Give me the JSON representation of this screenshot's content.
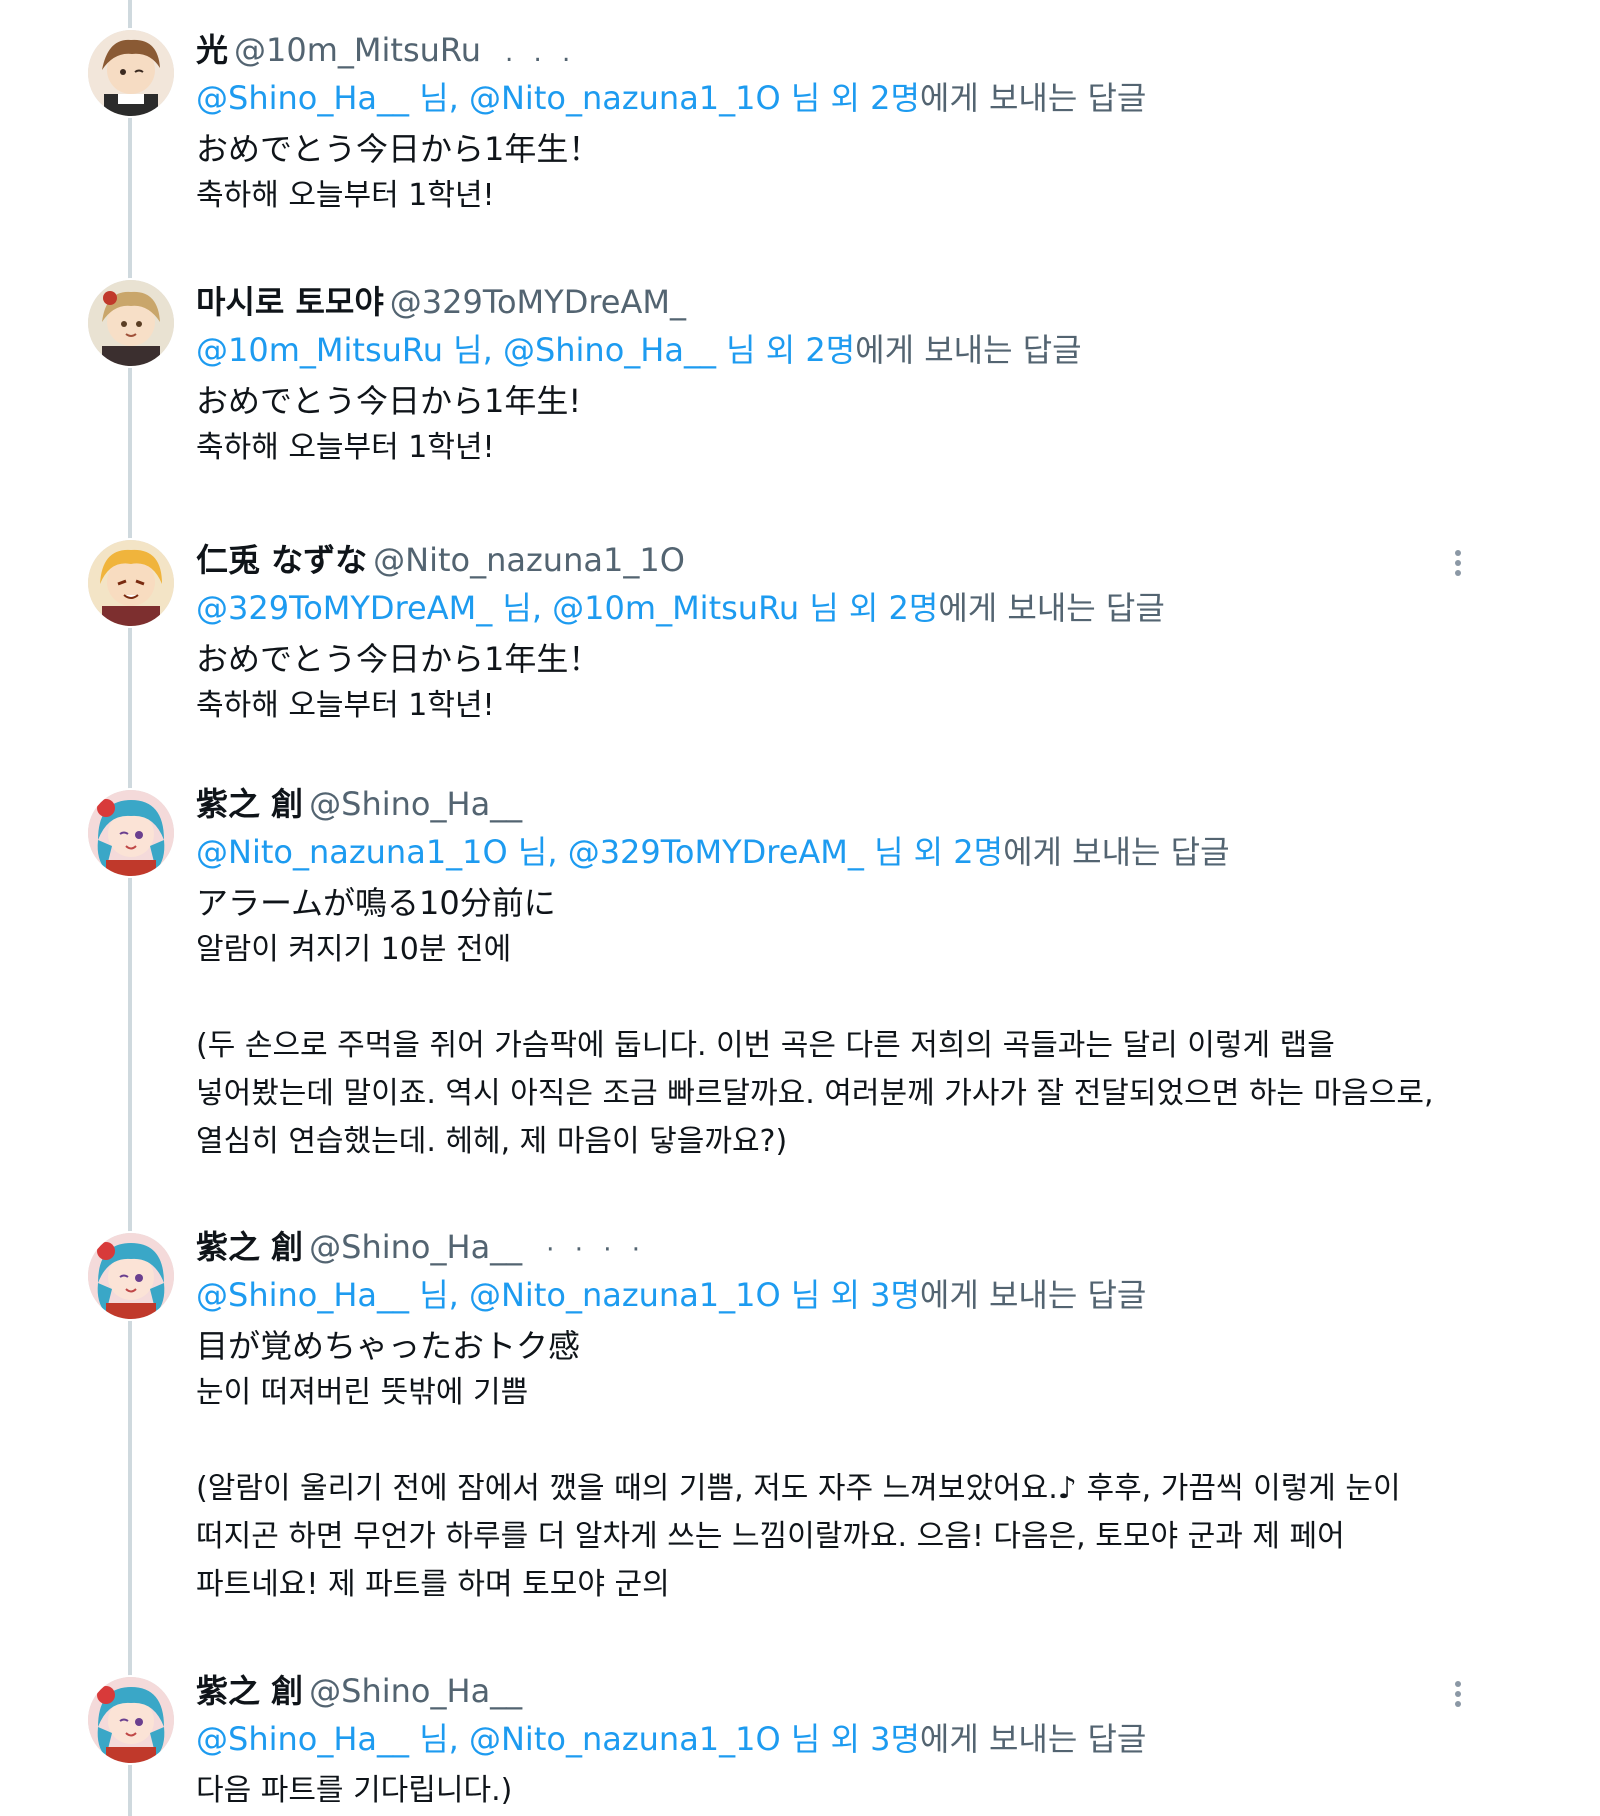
{
  "thread": {
    "reply_to_prefix_separator": "님,",
    "reply_to_middle": "님 외",
    "reply_to_suffix": "에게 보내는 답글"
  },
  "tweets": [
    {
      "display_name": "光",
      "handle": "@10m_MitsuRu",
      "trail": ". . .",
      "mention_1": "@Shino_Ha__",
      "mention_2": "@Nito_nazuna1_1O",
      "count": "2명",
      "lines_jp": [
        "おめでとう今日から1年生！"
      ],
      "lines_kr": [
        "축하해 오늘부터 1학년!"
      ]
    },
    {
      "display_name": "마시로 토모야",
      "handle": "@329ToMYDreAM_",
      "trail": "",
      "mention_1": "@10m_MitsuRu",
      "mention_2": "@Shino_Ha__",
      "count": "2명",
      "lines_jp": [
        "おめでとう今日から1年生!"
      ],
      "lines_kr": [
        "축하해 오늘부터 1학년!"
      ]
    },
    {
      "display_name": "仁兎 なずな",
      "handle": "@Nito_nazuna1_1O",
      "trail": "",
      "mention_1": "@329ToMYDreAM_",
      "mention_2": "@10m_MitsuRu",
      "count": "2명",
      "lines_jp": [
        "おめでとう今日から1年生！"
      ],
      "lines_kr": [
        "축하해 오늘부터 1학년!"
      ]
    },
    {
      "display_name": "紫之 創",
      "handle": "@Shino_Ha__",
      "trail": "",
      "mention_1": "@Nito_nazuna1_1O",
      "mention_2": "@329ToMYDreAM_",
      "count": "2명",
      "lines_jp": [
        "アラームが鳴る10分前に"
      ],
      "lines_kr": [
        "알람이 켜지기 10분 전에"
      ],
      "paragraph": [
        "(두 손으로 주먹을 쥐어 가슴팍에 둡니다. 이번 곡은 다른 저희의 곡들과는 달리 이렇게 랩을",
        "넣어봤는데 말이죠. 역시 아직은 조금 빠르달까요. 여러분께 가사가 잘 전달되었으면 하는 마음으로,",
        "열심히 연습했는데. 헤헤, 제 마음이 닿을까요?)"
      ]
    },
    {
      "display_name": "紫之 創",
      "handle": "@Shino_Ha__",
      "trail": "· · · ·",
      "mention_1": "@Shino_Ha__",
      "mention_2": "@Nito_nazuna1_1O",
      "count": "3명",
      "lines_jp": [
        "目が覚めちゃったおトク感"
      ],
      "lines_kr": [
        "눈이 떠져버린 뜻밖에 기쁨"
      ],
      "paragraph": [
        "(알람이 울리기 전에 잠에서 깼을 때의 기쁨, 저도 자주 느껴보았어요.♪ 후후, 가끔씩 이렇게 눈이",
        "떠지곤 하면 무언가 하루를 더 알차게 쓰는 느낌이랄까요. 으음! 다음은, 토모야 군과 제 페어",
        "파트네요! 제 파트를 하며 토모야 군의"
      ]
    },
    {
      "display_name": "紫之 創",
      "handle": "@Shino_Ha__",
      "trail": "",
      "mention_1": "@Shino_Ha__",
      "mention_2": "@Nito_nazuna1_1O",
      "count": "3명",
      "lines_jp": [],
      "lines_kr": [
        "다음 파트를 기다립니다.)"
      ]
    }
  ],
  "colors": {
    "link": "#1d9bf0",
    "secondary_text": "#536471",
    "primary_text": "#0f1419",
    "thread_line": "#cfd9de"
  },
  "icons": {
    "more": "more-vertical-icon"
  }
}
